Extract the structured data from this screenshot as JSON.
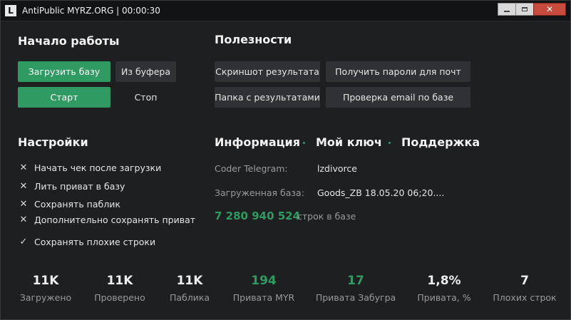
{
  "window": {
    "title": "AntiPublic MYRZ.ORG | 00:00:30",
    "icon_letter": "L",
    "close_glyph": "✕"
  },
  "start": {
    "heading": "Начало работы",
    "load_base": "Загрузить базу",
    "from_clipboard": "Из буфера",
    "start": "Старт",
    "stop": "Стоп"
  },
  "useful": {
    "heading": "Полезности",
    "screenshot": "Скриншот результата",
    "get_passwords": "Получить пароли для почт",
    "results_folder": "Папка с результатами",
    "check_email": "Проверка email по базе"
  },
  "settings": {
    "heading": "Настройки",
    "options": [
      {
        "mark": "✕",
        "label": "Начать чек после загрузки"
      },
      {
        "mark": "✕",
        "label": "Лить приват в базу"
      },
      {
        "mark": "✕",
        "label": "Сохранять паблик"
      },
      {
        "mark": "✕",
        "label": "Дополнительно сохранять приват"
      },
      {
        "mark": "✓",
        "label": "Сохранять плохие строки"
      }
    ]
  },
  "info": {
    "tabs": {
      "info": "Информация",
      "key": "Мой ключ",
      "support": "Поддержка"
    },
    "telegram_label": "Coder Telegram:",
    "telegram_value": "lzdivorce",
    "base_label": "Загруженная база:",
    "base_value": "Goods_ZB 18.05.20 06;20....",
    "count_value": "7 280 940 524",
    "count_label": "строк в базе"
  },
  "stats": [
    {
      "value": "11K",
      "label": "Загружено"
    },
    {
      "value": "11K",
      "label": "Проверено"
    },
    {
      "value": "11K",
      "label": "Паблика"
    },
    {
      "value": "194",
      "label": "Привата MYR"
    },
    {
      "value": "17",
      "label": "Привата Забугра"
    },
    {
      "value": "1,8%",
      "label": "Привата, %"
    },
    {
      "value": "7",
      "label": "Плохих строк"
    }
  ],
  "colors": {
    "accent": "#2f9a62",
    "background": "#1e1f21",
    "button": "#303134"
  }
}
